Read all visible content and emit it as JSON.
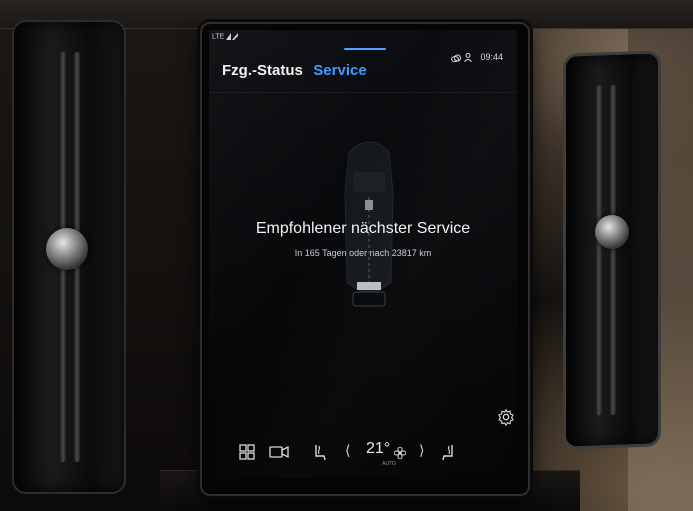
{
  "status_bar": {
    "signal_text": "LTE",
    "time": "09:44",
    "status_icons": [
      "cloud-icon",
      "person-icon"
    ]
  },
  "tabs": [
    {
      "label": "Fzg.-Status",
      "active": false
    },
    {
      "label": "Service",
      "active": true
    }
  ],
  "service": {
    "headline": "Empfohlener nächster Service",
    "detail": "In 165 Tagen oder nach 23817 km"
  },
  "climate": {
    "temperature": "21°",
    "fan_icon": "fan-icon",
    "mode": "AUTO"
  },
  "bottom_bar_icons": [
    "home-grid-icon",
    "camera-icon",
    "seat-heat-left-icon",
    "chevron-left-icon",
    "chevron-right-icon",
    "seat-heat-right-icon",
    "settings-icon"
  ],
  "colors": {
    "accent": "#3d9bff",
    "screen_bg": "#07080a",
    "text": "#f1f2f4"
  }
}
